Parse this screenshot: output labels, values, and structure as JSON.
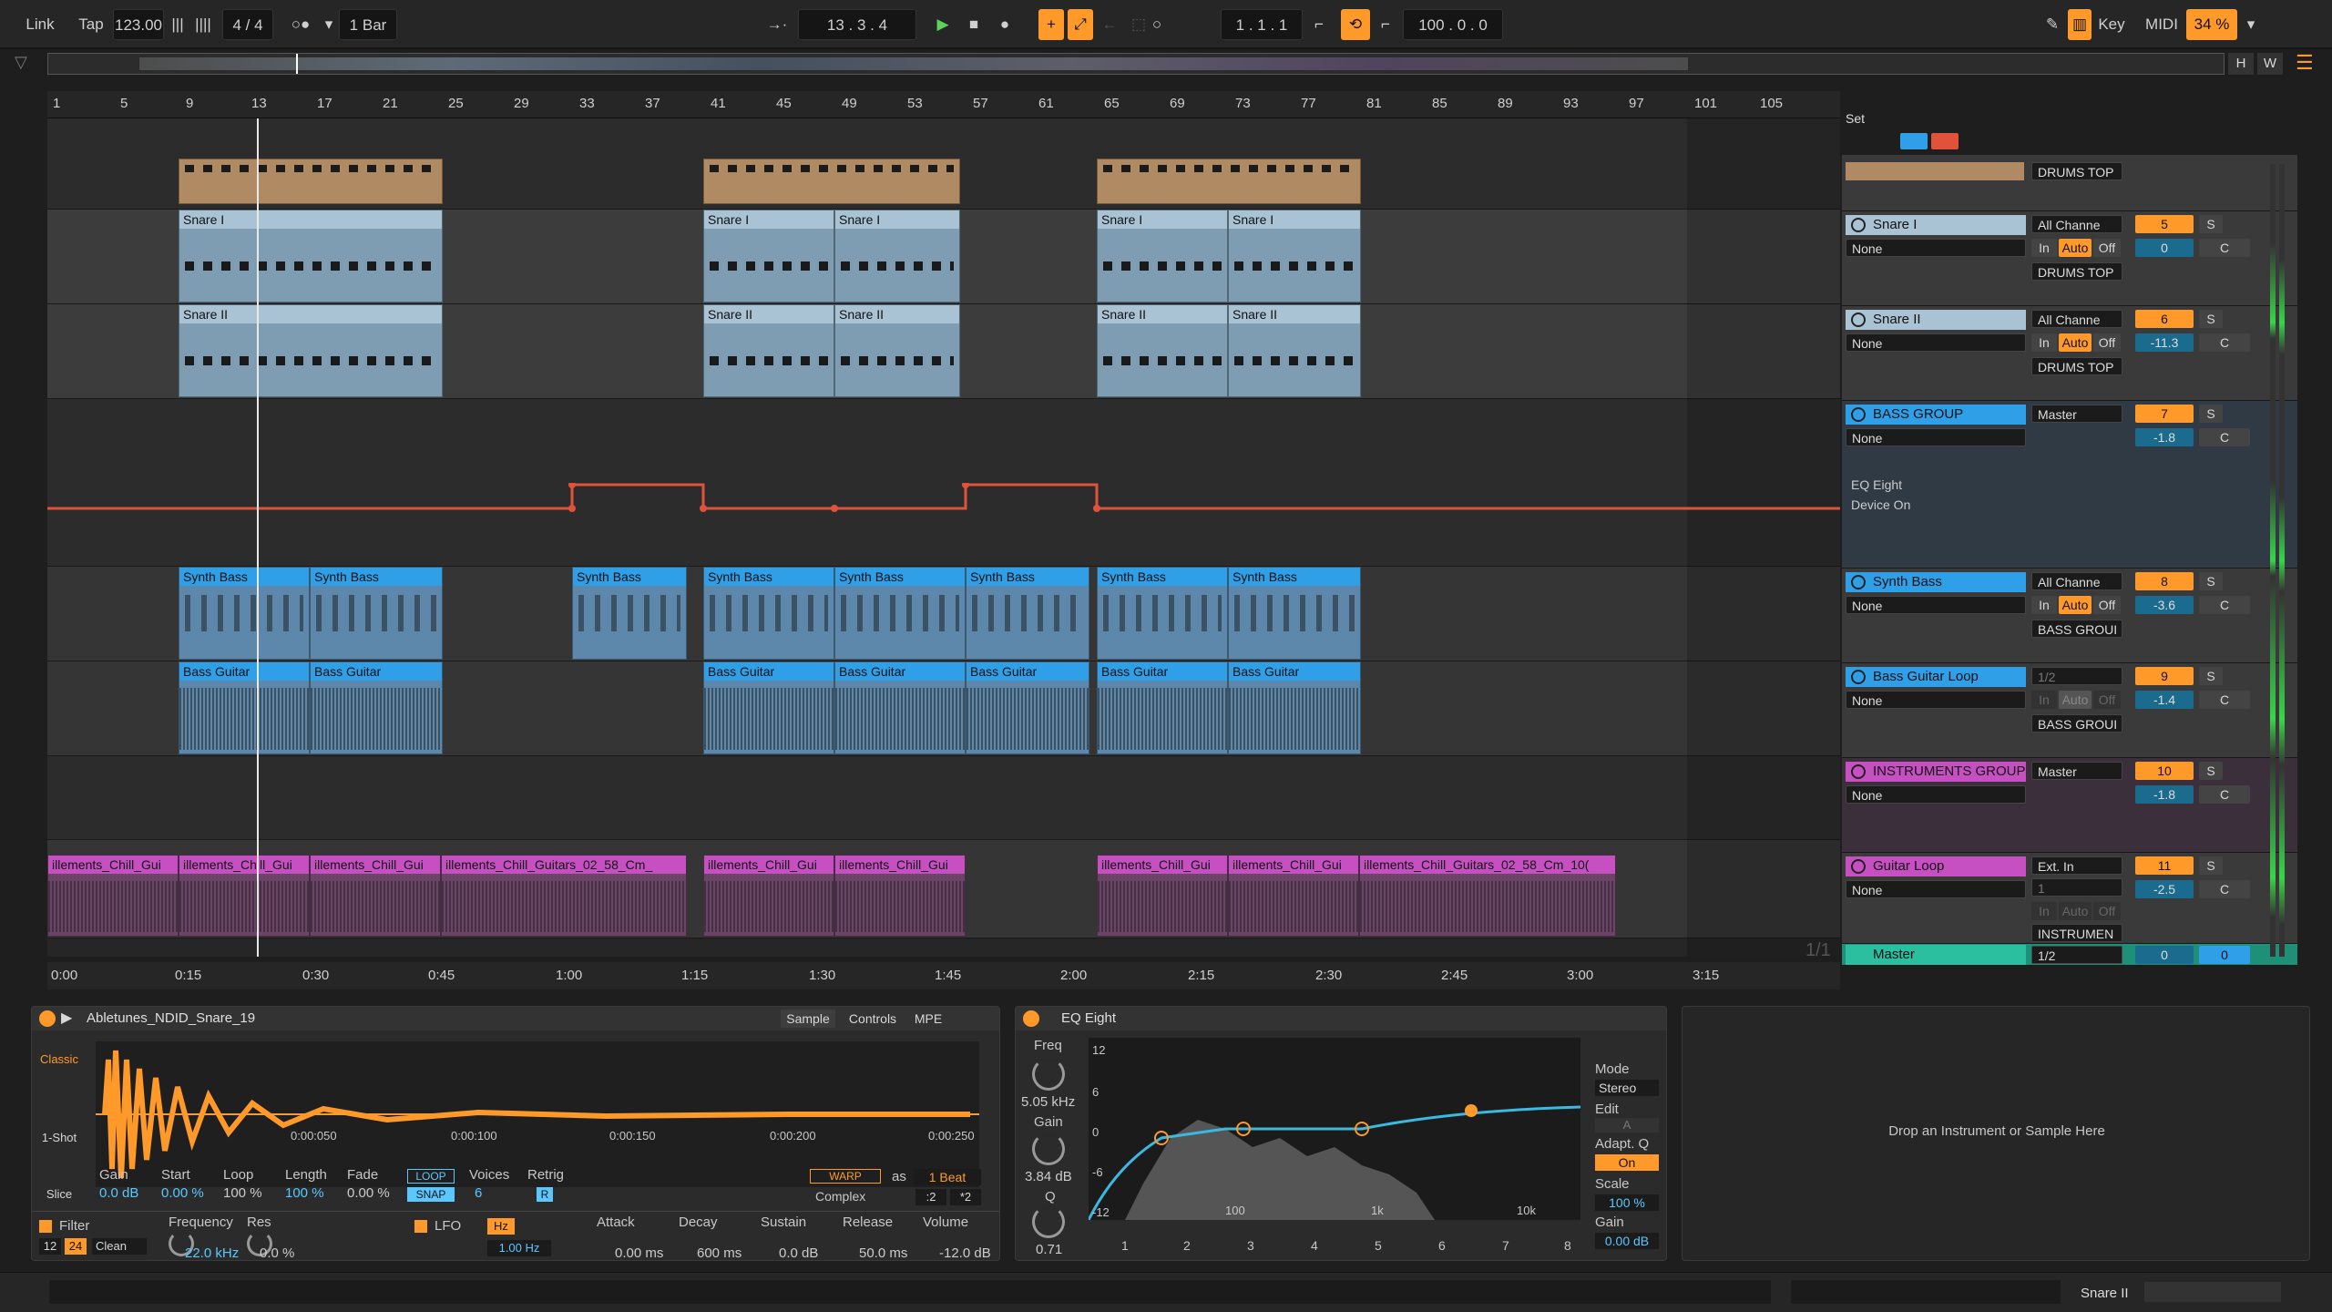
{
  "transport": {
    "link": "Link",
    "tap": "Tap",
    "tempo": "123.00",
    "signature": "4 / 4",
    "quantize": "1 Bar",
    "position": "13 .  3 .  4",
    "loop_start": "1 .  1 .  1",
    "loop_length": "100 .  0 .  0",
    "key": "Key",
    "midi": "MIDI",
    "cpu": "34 %",
    "h": "H",
    "w": "W"
  },
  "ruler": {
    "bars": [
      "1",
      "5",
      "9",
      "13",
      "17",
      "21",
      "25",
      "29",
      "33",
      "37",
      "41",
      "45",
      "49",
      "53",
      "57",
      "61",
      "65",
      "69",
      "73",
      "77",
      "81",
      "85",
      "89",
      "93",
      "97",
      "101",
      "105"
    ]
  },
  "time_ruler": {
    "labels": [
      "0:00",
      "0:15",
      "0:30",
      "0:45",
      "1:00",
      "1:15",
      "1:30",
      "1:45",
      "2:00",
      "2:15",
      "2:30",
      "2:45",
      "3:00",
      "3:15"
    ],
    "loop_badge": "1/1"
  },
  "clips": {
    "snare1": "Snare I",
    "snare2": "Snare II",
    "synth_bass": "Synth Bass",
    "bass_guitar": "Bass Guitar",
    "guitar_a": "illements_Chill_Gui",
    "guitar_long": "illements_Chill_Guitars_02_58_Cm_",
    "guitar_long2": "illements_Chill_Guitars_02_58_Cm_10("
  },
  "session": {
    "label": "Set"
  },
  "tracks": [
    {
      "id": "drums-top",
      "name": "",
      "routing": "DRUMS TOP",
      "num": "",
      "vol": ""
    },
    {
      "id": "snare1",
      "name": "Snare I",
      "input": "None",
      "channel": "All Channe",
      "out": "DRUMS TOP",
      "num": "5",
      "vol": "0",
      "pan": "C",
      "s": "S",
      "in": "In",
      "auto": "Auto",
      "off": "Off"
    },
    {
      "id": "snare2",
      "name": "Snare II",
      "input": "None",
      "channel": "All Channe",
      "out": "DRUMS TOP",
      "num": "6",
      "vol": "-11.3",
      "pan": "C",
      "s": "S",
      "in": "In",
      "auto": "Auto",
      "off": "Off"
    },
    {
      "id": "bass-group",
      "name": "BASS GROUP",
      "input": "None",
      "out": "Master",
      "num": "7",
      "vol": "-1.8",
      "pan": "C",
      "s": "S",
      "device": "EQ Eight",
      "param": "Device On"
    },
    {
      "id": "synth-bass",
      "name": "Synth Bass",
      "input": "None",
      "channel": "All Channe",
      "out": "BASS GROUI",
      "num": "8",
      "vol": "-3.6",
      "pan": "C",
      "s": "S",
      "in": "In",
      "auto": "Auto",
      "off": "Off"
    },
    {
      "id": "bass-guitar",
      "name": "Bass Guitar Loop",
      "input": "None",
      "channel": "1/2",
      "out": "BASS GROUI",
      "num": "9",
      "vol": "-1.4",
      "pan": "C",
      "s": "S",
      "in": "In",
      "auto": "Auto",
      "off": "Off"
    },
    {
      "id": "inst-group",
      "name": "INSTRUMENTS GROUP",
      "input": "None",
      "out": "Master",
      "num": "10",
      "vol": "-1.8",
      "pan": "C",
      "s": "S"
    },
    {
      "id": "guitar-loop",
      "name": "Guitar Loop",
      "input": "None",
      "channel": "Ext. In",
      "chan2": "1",
      "out": "INSTRUMEN",
      "num": "11",
      "vol": "-2.5",
      "pan": "C",
      "s": "S",
      "in": "In",
      "auto": "Auto",
      "off": "Off"
    },
    {
      "id": "master",
      "name": "Master",
      "out": "1/2",
      "num": "0",
      "vol": "0"
    }
  ],
  "simpler": {
    "title": "Abletunes_NDID_Snare_19",
    "tabs": [
      "Sample",
      "Controls",
      "MPE"
    ],
    "modes": [
      "Classic",
      "1-Shot",
      "Slice"
    ],
    "time_marks": [
      "0:00:050",
      "0:00:100",
      "0:00:150",
      "0:00:200",
      "0:00:250"
    ],
    "params": {
      "gain": "Gain",
      "gain_v": "0.0 dB",
      "start": "Start",
      "start_v": "0.00 %",
      "loop": "Loop",
      "loop_v": "100 %",
      "length": "Length",
      "length_v": "100 %",
      "fade": "Fade",
      "fade_v": "0.00 %",
      "loop_btn": "LOOP",
      "snap_btn": "SNAP",
      "voices": "Voices",
      "voices_v": "6",
      "retrig": "Retrig",
      "retrig_v": "R",
      "warp": "WARP",
      "as": "as",
      "beat": "1 Beat",
      "complex": "Complex",
      "div": ":2",
      "mul": "*2"
    },
    "filter": {
      "label": "Filter",
      "freq": "Frequency",
      "freq_v": "22.0 kHz",
      "res": "Res",
      "res_v": "0.0 %",
      "n12": "12",
      "n24": "24",
      "clean": "Clean"
    },
    "lfo": {
      "label": "LFO",
      "hz": "Hz",
      "rate": "1.00 Hz"
    },
    "env": {
      "attack": "Attack",
      "attack_v": "0.00 ms",
      "decay": "Decay",
      "decay_v": "600 ms",
      "sustain": "Sustain",
      "sustain_v": "0.0 dB",
      "release": "Release",
      "release_v": "50.0 ms",
      "volume": "Volume",
      "volume_v": "-12.0 dB"
    }
  },
  "eq": {
    "title": "EQ Eight",
    "freq": "Freq",
    "freq_v": "5.05 kHz",
    "gain": "Gain",
    "gain_v": "3.84 dB",
    "q": "Q",
    "q_v": "0.71",
    "db_marks": [
      "12",
      "6",
      "0",
      "-6",
      "-12"
    ],
    "hz_marks": [
      "100",
      "1k",
      "10k"
    ],
    "mode": "Mode",
    "mode_v": "Stereo",
    "edit": "Edit",
    "edit_v": "A",
    "adapt": "Adapt. Q",
    "adapt_v": "On",
    "scale": "Scale",
    "scale_v": "100 %",
    "gain2": "Gain",
    "gain2_v": "0.00 dB",
    "bands": [
      "1",
      "2",
      "3",
      "4",
      "5",
      "6",
      "7",
      "8"
    ]
  },
  "drop_zone": "Drop an Instrument or Sample Here",
  "status": {
    "track": "Snare II"
  },
  "colors": {
    "accent": "#ff9a2a",
    "snare": "#8fb2c9",
    "bass": "#2f9fe8",
    "drums": "#b08a62",
    "guitar": "#c64fc1",
    "master": "#2bbfa0",
    "auto": "#e0523a"
  }
}
